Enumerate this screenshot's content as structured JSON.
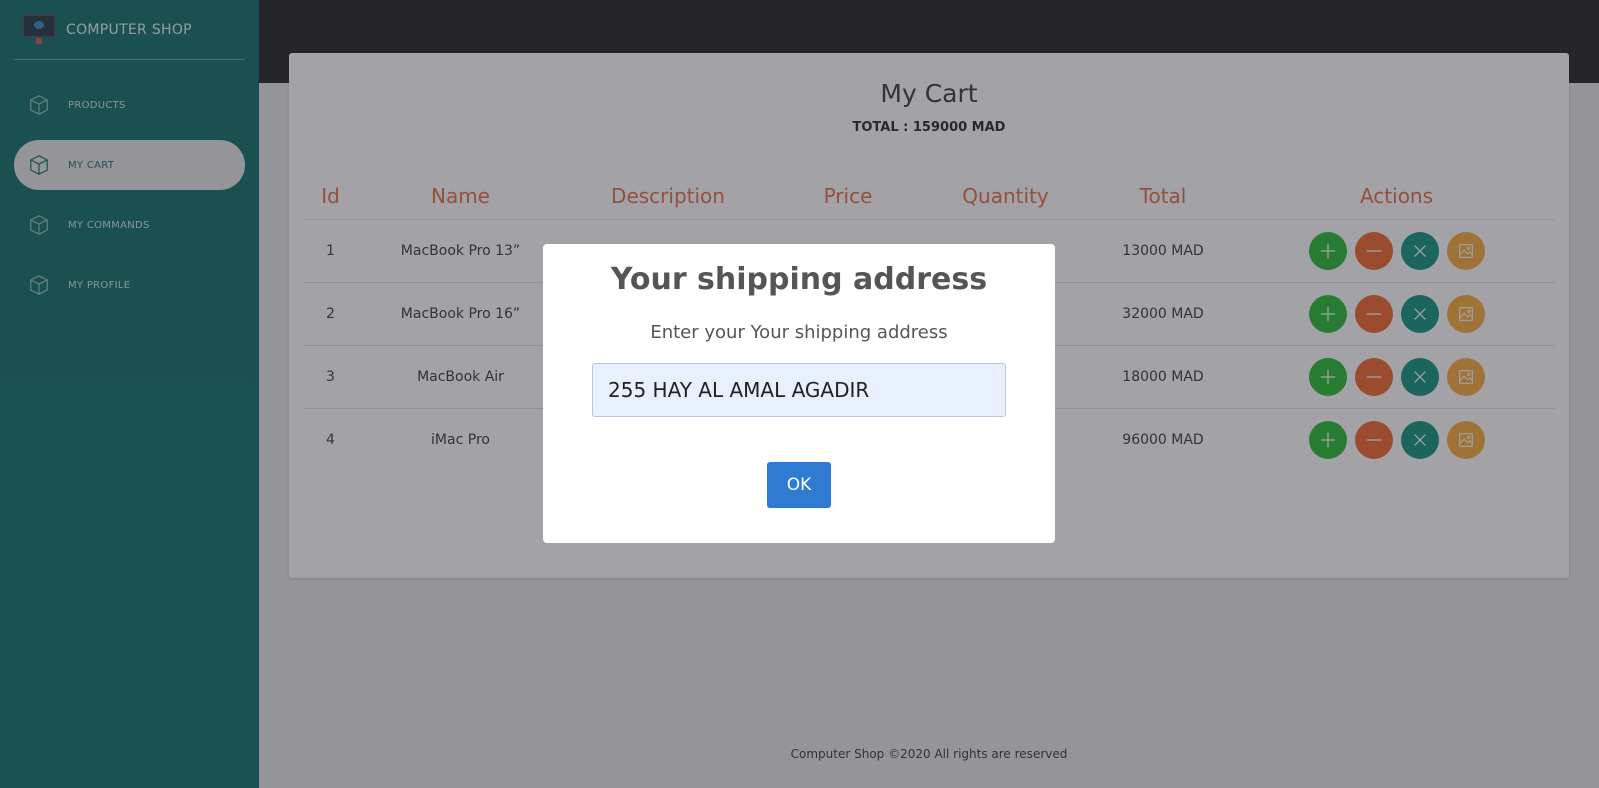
{
  "brand": {
    "title": "COMPUTER SHOP"
  },
  "sidebar": {
    "items": [
      {
        "label": "PRODUCTS",
        "active": false
      },
      {
        "label": "MY CART",
        "active": true
      },
      {
        "label": "MY COMMANDS",
        "active": false
      },
      {
        "label": "MY PROFILE",
        "active": false
      }
    ]
  },
  "cart": {
    "title": "My Cart",
    "total": "TOTAL : 159000 MAD",
    "columns": [
      "Id",
      "Name",
      "Description",
      "Price",
      "Quantity",
      "Total",
      "Actions"
    ],
    "rows": [
      {
        "id": "1",
        "name": "MacBook Pro 13”",
        "total": "13000 MAD"
      },
      {
        "id": "2",
        "name": "MacBook Pro 16”",
        "total": "32000 MAD"
      },
      {
        "id": "3",
        "name": "MacBook Air",
        "total": "18000 MAD"
      },
      {
        "id": "4",
        "name": "iMac Pro",
        "total": "96000 MAD"
      }
    ]
  },
  "modal": {
    "title": "Your shipping address",
    "label": "Enter your Your shipping address",
    "input_value": "255 HAY AL AMAL AGADIR",
    "ok_label": "OK"
  },
  "footer": {
    "text": "Computer Shop ©2020 All rights are reserved"
  },
  "colors": {
    "sidebar": "#066b62",
    "accent": "#e2683c",
    "add": "#1eb82b",
    "remove": "#f16226",
    "delete": "#0a8c7a",
    "image": "#f7a734",
    "ok": "#2f7bd2"
  }
}
